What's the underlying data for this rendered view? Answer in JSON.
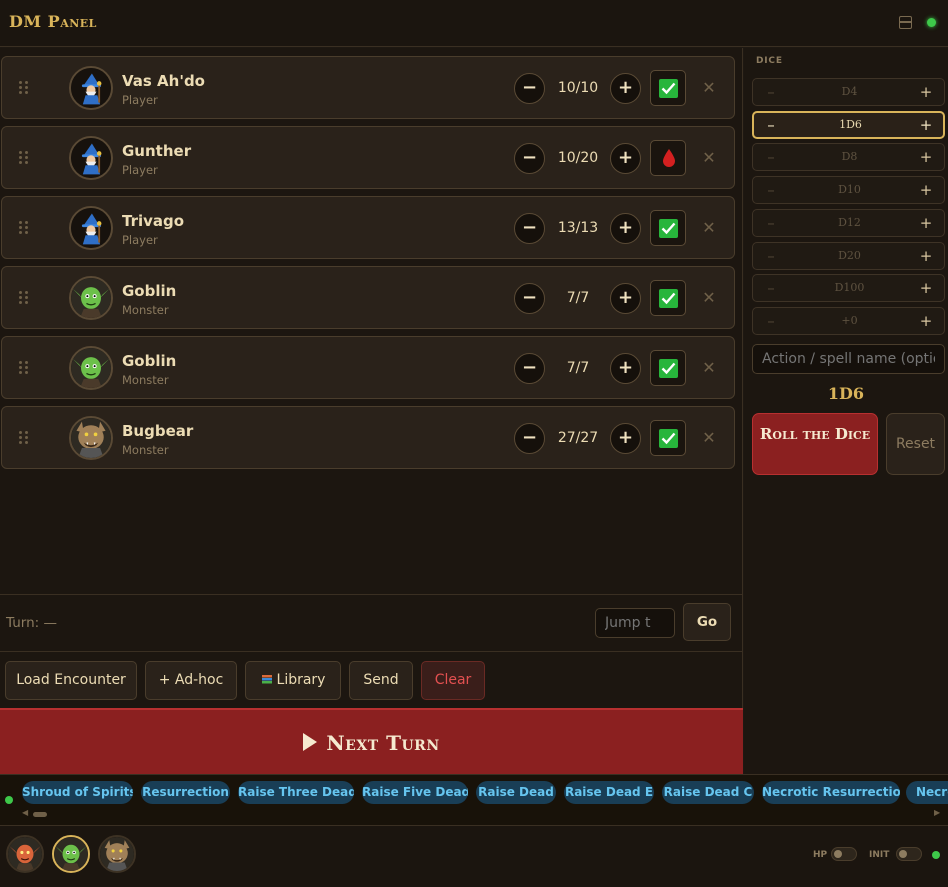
{
  "app": {
    "title": "DM Panel"
  },
  "combatants": [
    {
      "name": "Vas Ah'do",
      "role": "Player",
      "hp": "10/10",
      "status": "ok",
      "avatar": "wizard-icon"
    },
    {
      "name": "Gunther",
      "role": "Player",
      "hp": "10/20",
      "status": "bloodied",
      "avatar": "wizard-icon"
    },
    {
      "name": "Trivago",
      "role": "Player",
      "hp": "13/13",
      "status": "ok",
      "avatar": "wizard-icon"
    },
    {
      "name": "Goblin",
      "role": "Monster",
      "hp": "7/7",
      "status": "ok",
      "avatar": "goblin-icon"
    },
    {
      "name": "Goblin",
      "role": "Monster",
      "hp": "7/7",
      "status": "ok",
      "avatar": "goblin-icon"
    },
    {
      "name": "Bugbear",
      "role": "Monster",
      "hp": "27/27",
      "status": "ok",
      "avatar": "bugbear-icon"
    }
  ],
  "turn": {
    "label": "Turn: —",
    "jump_placeholder": "Jump t",
    "go_label": "Go"
  },
  "actions": {
    "load": "Load Encounter",
    "adhoc": "+ Ad-hoc",
    "library": "Library",
    "send": "Send",
    "clear": "Clear"
  },
  "next_turn": {
    "label": "Next Turn"
  },
  "dice": {
    "header": "DICE",
    "items": [
      {
        "label": "D4",
        "active": false
      },
      {
        "label": "1D6",
        "active": true
      },
      {
        "label": "D8",
        "active": false
      },
      {
        "label": "D10",
        "active": false
      },
      {
        "label": "D12",
        "active": false
      },
      {
        "label": "D20",
        "active": false
      },
      {
        "label": "D100",
        "active": false
      },
      {
        "label": "+0",
        "active": false
      }
    ],
    "minus": "–",
    "plus": "+",
    "action_placeholder": "Action / spell name (optional)",
    "formula": "1D6",
    "roll_label": "Roll the Dice",
    "reset_label": "Reset"
  },
  "spells": [
    "Shroud of Spirits",
    "Resurrection",
    "Raise Three Dead",
    "Raise Five Dead",
    "Raise Dead",
    "Raise Dead E",
    "Raise Dead C",
    "Necrotic Resurrection",
    "Necrotic"
  ],
  "tray": {
    "avatars": [
      "red-goblin-icon",
      "goblin-icon",
      "bugbear-icon"
    ],
    "hp_label": "HP",
    "init_label": "INIT"
  },
  "colors": {
    "accent": "#d9b45a",
    "danger": "#8b2020",
    "chip_bg": "#193e56",
    "chip_text": "#66c5ef",
    "ok": "#27b53b"
  }
}
